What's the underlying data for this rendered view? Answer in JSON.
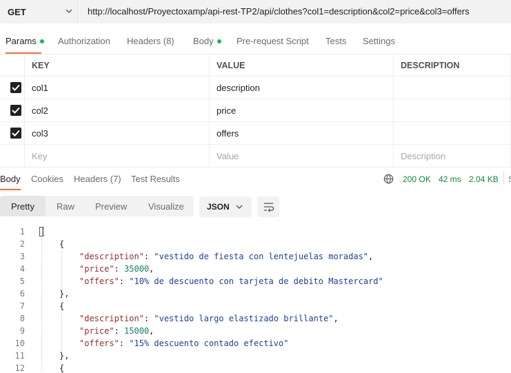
{
  "request": {
    "method": "GET",
    "url": "http://localhost/Proyectoxamp/api-rest-TP2/api/clothes?col1=description&col2=price&col3=offers"
  },
  "request_tabs": [
    {
      "label": "Params"
    },
    {
      "label": "Authorization"
    },
    {
      "label": "Headers (8)"
    },
    {
      "label": "Body"
    },
    {
      "label": "Pre-request Script"
    },
    {
      "label": "Tests"
    },
    {
      "label": "Settings"
    }
  ],
  "params": {
    "headers": {
      "key": "KEY",
      "value": "VALUE",
      "description": "DESCRIPTION"
    },
    "rows": [
      {
        "checked": true,
        "key": "col1",
        "value": "description",
        "description": ""
      },
      {
        "checked": true,
        "key": "col2",
        "value": "price",
        "description": ""
      },
      {
        "checked": true,
        "key": "col3",
        "value": "offers",
        "description": ""
      }
    ],
    "placeholders": {
      "key": "Key",
      "value": "Value",
      "description": "Description"
    }
  },
  "response_tabs": [
    {
      "label": "Body"
    },
    {
      "label": "Cookies"
    },
    {
      "label": "Headers (7)"
    },
    {
      "label": "Test Results"
    }
  ],
  "status": {
    "icon": "globe-icon",
    "code": "200 OK",
    "time": "42 ms",
    "size": "2.04 KB",
    "more": "S"
  },
  "view_modes": [
    "Pretty",
    "Raw",
    "Preview",
    "Visualize"
  ],
  "format": "JSON",
  "code": {
    "line_numbers": [
      "1",
      "2",
      "3",
      "4",
      "5",
      "6",
      "7",
      "8",
      "9",
      "10",
      "11",
      "12"
    ],
    "lines": [
      {
        "text": "["
      },
      {
        "text": "{"
      },
      {
        "key": "\"description\"",
        "colon": ": ",
        "value": "\"vestido de fiesta con lentejuelas moradas\"",
        "end": ","
      },
      {
        "key": "\"price\"",
        "colon": ": ",
        "value": "35000",
        "end": ","
      },
      {
        "key": "\"offers\"",
        "colon": ": ",
        "value": "\"10% de descuento con tarjeta de debito Mastercard\"",
        "end": ""
      },
      {
        "text": "},"
      },
      {
        "text": "{"
      },
      {
        "key": "\"description\"",
        "colon": ": ",
        "value": "\"vestido largo elastizado brillante\"",
        "end": ","
      },
      {
        "key": "\"price\"",
        "colon": ": ",
        "value": "15000",
        "end": ","
      },
      {
        "key": "\"offers\"",
        "colon": ": ",
        "value": "\"15% descuento contado efectivo\"",
        "end": ""
      },
      {
        "text": "},"
      },
      {
        "text": "{"
      }
    ]
  },
  "colors": {
    "accent": "#ff6c37",
    "status_ok": "#0a8a3a",
    "dot": "#0cbb52"
  }
}
